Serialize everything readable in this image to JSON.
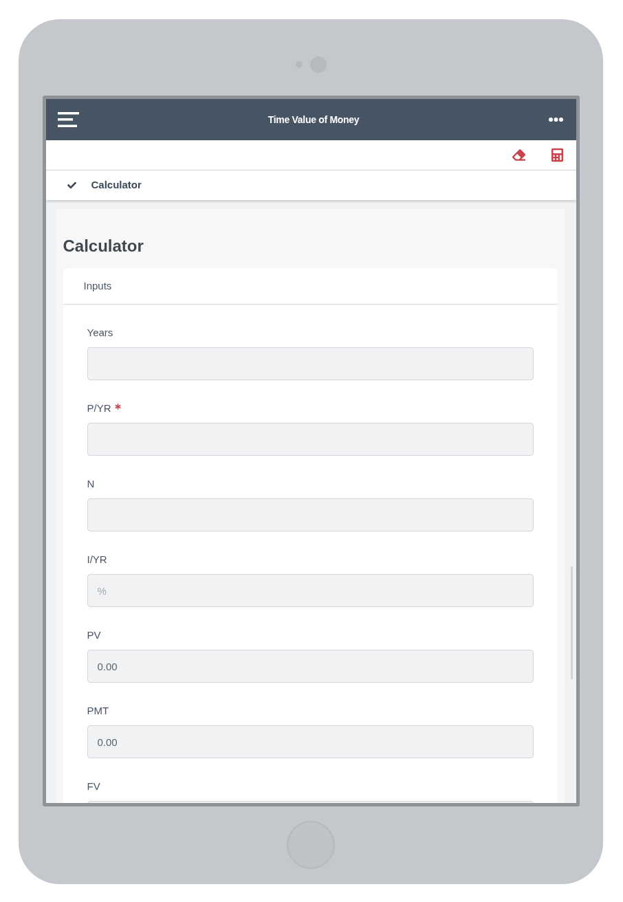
{
  "header": {
    "title": "Time Value of Money"
  },
  "breadcrumb": {
    "label": "Calculator"
  },
  "panel": {
    "title": "Calculator"
  },
  "card": {
    "title": "Inputs",
    "fields": [
      {
        "label": "Years",
        "required": false
      },
      {
        "label": "P/YR",
        "required": true
      },
      {
        "label": "N",
        "required": false
      },
      {
        "label": "I/YR",
        "required": false,
        "placeholder": "%"
      },
      {
        "label": "PV",
        "required": false,
        "value": "0.00"
      },
      {
        "label": "PMT",
        "required": false,
        "value": "0.00"
      },
      {
        "label": "FV",
        "required": false
      }
    ]
  }
}
